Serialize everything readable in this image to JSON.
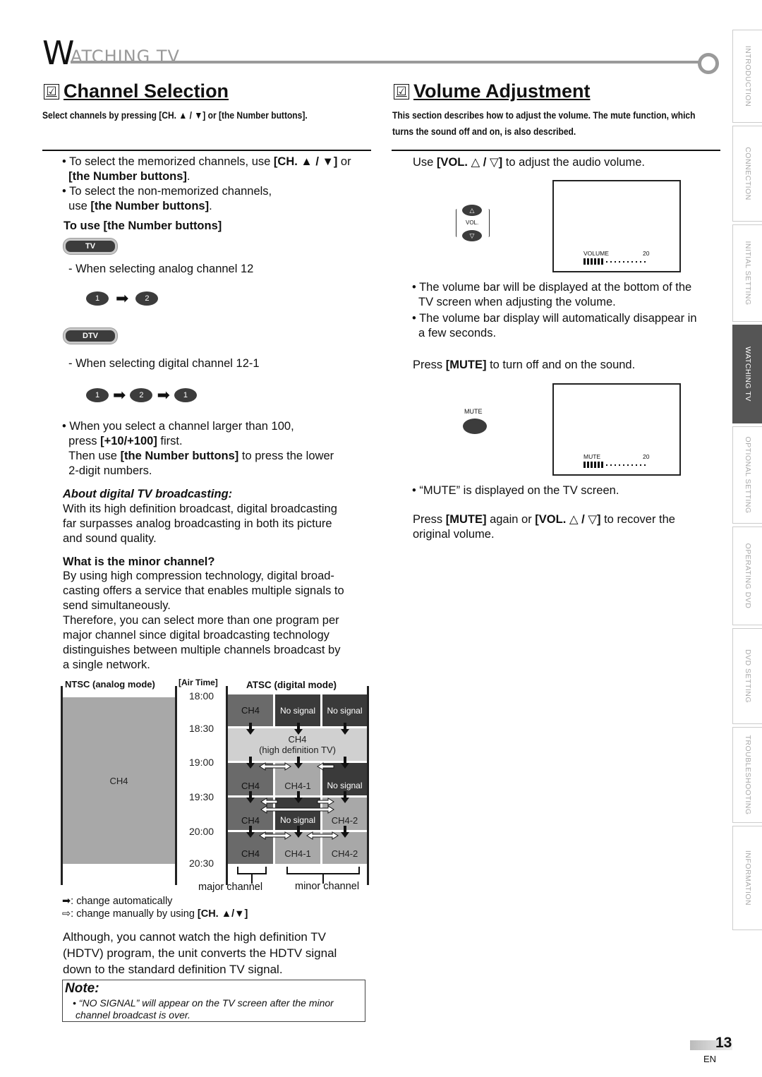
{
  "header": {
    "title_initial": "W",
    "title_rest": "ATCHING  TV"
  },
  "side_tabs": [
    {
      "label": "INTRODUCTION",
      "active": false
    },
    {
      "label": "CONNECTION",
      "active": false
    },
    {
      "label": "INITIAL  SETTING",
      "active": false
    },
    {
      "label": "WATCHING  TV",
      "active": true
    },
    {
      "label": "OPTIONAL  SETTING",
      "active": false
    },
    {
      "label": "OPERATING  DVD",
      "active": false
    },
    {
      "label": "DVD  SETTING",
      "active": false
    },
    {
      "label": "TROUBLESHOOTING",
      "active": false
    },
    {
      "label": "INFORMATION",
      "active": false
    }
  ],
  "channel": {
    "checkbox": "☑",
    "title": "Channel Selection",
    "subtitle": "Select channels by pressing [CH. ▲ / ▼] or [the Number buttons].",
    "bullet1_a": "To select the memorized channels, use ",
    "bullet1_b": "[CH. ▲ / ▼]",
    "bullet1_c": " or",
    "bullet1_d": "[the Number buttons]",
    "bullet1_e": ".",
    "bullet2_a": "To select the non-memorized channels,",
    "bullet2_b": "use ",
    "bullet2_c": "[the Number buttons]",
    "bullet2_d": ".",
    "number_heading": "To use [the Number buttons]",
    "tv_button": "TV",
    "analog_text": "- When selecting analog channel 12",
    "analog_keys": [
      "1",
      "2"
    ],
    "dtv_button": "DTV",
    "digital_text": "- When selecting digital channel 12-1",
    "digital_keys": [
      "1",
      "2",
      "1"
    ],
    "over100_a": "When you select a channel larger than 100,",
    "over100_b": "press ",
    "over100_c": "[+10/+100]",
    "over100_d": " first.",
    "over100_e": "Then use ",
    "over100_f": "[the Number buttons]",
    "over100_g": " to press the lower",
    "over100_h": "2-digit numbers.",
    "about_heading": "About digital TV broadcasting:",
    "about_lines": [
      "With its high definition broadcast, digital broadcasting",
      "far surpasses analog broadcasting in both its picture",
      "and sound quality."
    ],
    "minor_heading": "What is the minor channel?",
    "minor_lines": [
      "By using high compression technology, digital broad-",
      "casting offers a service that enables multiple signals to",
      "send simultaneously.",
      "Therefore, you can select more than one program per",
      "major channel since digital broadcasting technology",
      "distinguishes between multiple channels broadcast by",
      "a single network."
    ],
    "hdtv_lines": [
      "Although, you cannot watch the high definition TV",
      "(HDTV) program, the unit converts the HDTV signal",
      "down to the standard definition TV signal."
    ],
    "note_title": "Note:",
    "note_text_1": "• “NO SIGNAL” will appear on the TV screen after the minor",
    "note_text_2": "channel broadcast is over."
  },
  "diagram": {
    "ntsc_label": "NTSC (analog mode)",
    "airtime_label": "[Air Time]",
    "atsc_label": "ATSC (digital mode)",
    "ntsc_channel": "CH4",
    "times": [
      "18:00",
      "18:30",
      "19:00",
      "19:30",
      "20:00",
      "20:30"
    ],
    "row1": [
      "CH4",
      "No signal",
      "No signal"
    ],
    "row2_a": "CH4",
    "row2_b": "(high definition TV)",
    "row3": [
      "CH4",
      "CH4-1",
      "No signal"
    ],
    "row4": [
      "CH4",
      "No signal",
      "CH4-2"
    ],
    "row5": [
      "CH4",
      "CH4-1",
      "CH4-2"
    ],
    "major_label": "major channel",
    "minor_label": "minor channel",
    "legend_auto": ": change automatically",
    "legend_manual_a": ": change manually by using ",
    "legend_manual_b": "[CH. ▲/▼]"
  },
  "volume": {
    "checkbox": "☑",
    "title": "Volume Adjustment",
    "subtitle_1": "This section describes how to adjust the volume. The mute function, which",
    "subtitle_2": "turns the sound off and on, is also described.",
    "use_a": "Use ",
    "use_b": "[VOL. △ / ▽]",
    "use_c": " to adjust the audio volume.",
    "vol_button_label": "VOL.",
    "vol_up": "△",
    "vol_down": "▽",
    "screen1_label": "VOLUME",
    "screen1_value": "20",
    "bullet1_a": "The volume bar will be displayed at the bottom of the",
    "bullet1_b": "TV screen when adjusting the volume.",
    "bullet2_a": "The volume bar display will automatically disappear in",
    "bullet2_b": "a few seconds.",
    "mute_a": "Press ",
    "mute_b": "[MUTE]",
    "mute_c": " to turn off and on the sound.",
    "mute_button_label": "MUTE",
    "screen2_label": "MUTE",
    "screen2_value": "20",
    "mute_shown": "• “MUTE” is displayed on the TV screen.",
    "recover_a": "Press ",
    "recover_b": "[MUTE]",
    "recover_c": " again or ",
    "recover_d": "[VOL. △ / ▽]",
    "recover_e": " to recover the",
    "recover_f": "original volume."
  },
  "footer": {
    "page_number": "13",
    "language": "EN"
  }
}
